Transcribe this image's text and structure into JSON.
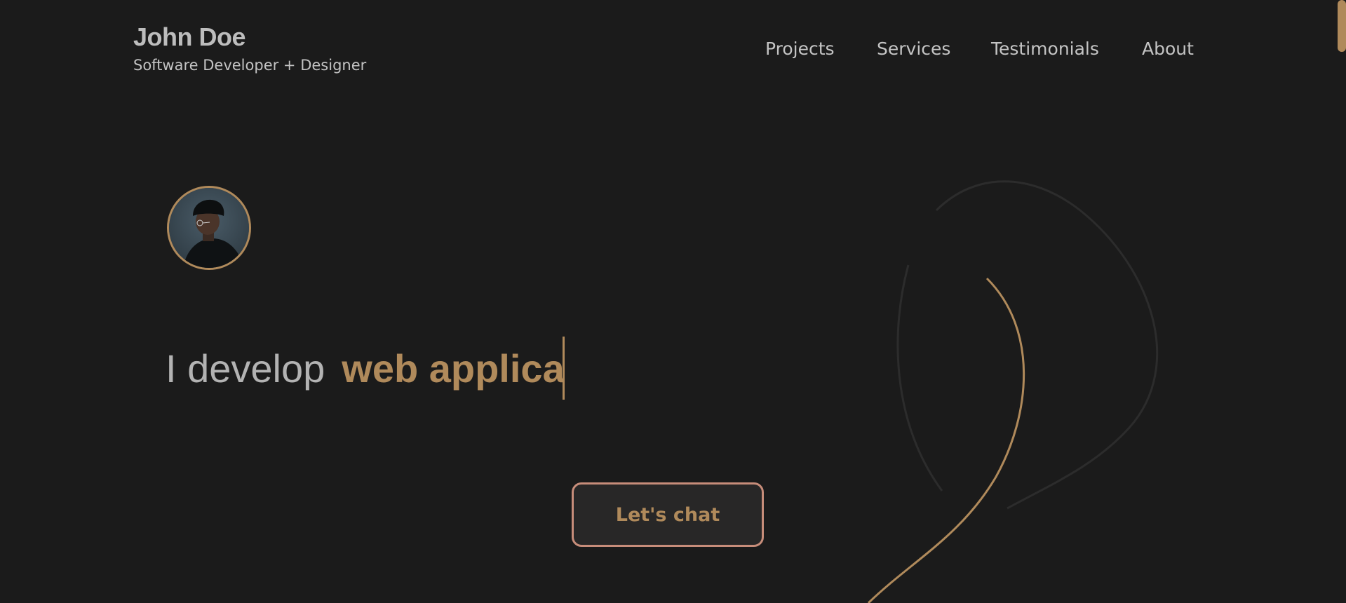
{
  "header": {
    "name": "John Doe",
    "subtitle": "Software Developer + Designer"
  },
  "nav": {
    "items": [
      {
        "label": "Projects"
      },
      {
        "label": "Services"
      },
      {
        "label": "Testimonials"
      },
      {
        "label": "About"
      }
    ]
  },
  "hero": {
    "static_text": "I develop",
    "typed_text": "web applica"
  },
  "cta": {
    "label": "Let's chat"
  },
  "colors": {
    "background": "#1b1b1b",
    "accent": "#b08a5b",
    "button_border": "#c78d7a",
    "text": "#c4c4c4"
  },
  "icons": {
    "avatar": "profile-photo"
  }
}
